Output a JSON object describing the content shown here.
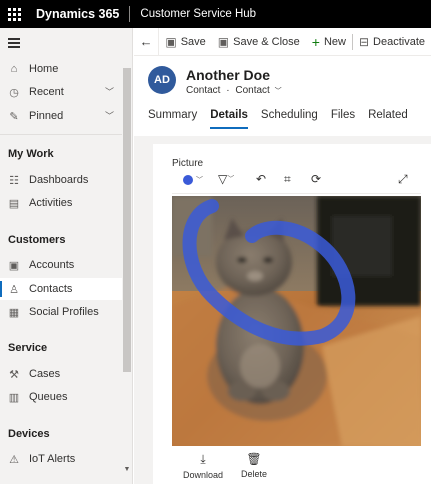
{
  "topbar": {
    "brand": "Dynamics 365",
    "app_name": "Customer Service Hub"
  },
  "commandbar": {
    "save": "Save",
    "save_close": "Save & Close",
    "new": "New",
    "deactivate": "Deactivate"
  },
  "sidebar": {
    "home": "Home",
    "recent": "Recent",
    "pinned": "Pinned",
    "groups": {
      "my_work": "My Work",
      "customers": "Customers",
      "service": "Service",
      "devices": "Devices"
    },
    "dashboards": "Dashboards",
    "activities": "Activities",
    "accounts": "Accounts",
    "contacts": "Contacts",
    "social_profiles": "Social Profiles",
    "cases": "Cases",
    "queues": "Queues",
    "iot_alerts": "IoT Alerts"
  },
  "record": {
    "initials": "AD",
    "name": "Another Doe",
    "entity": "Contact",
    "form": "Contact"
  },
  "tabs": [
    "Summary",
    "Details",
    "Scheduling",
    "Files",
    "Related"
  ],
  "picture": {
    "label": "Picture",
    "download": "Download",
    "delete": "Delete"
  },
  "colors": {
    "accent": "#0f6cbd",
    "pen": "#3a5ad8",
    "avatar": "#305a9c"
  }
}
